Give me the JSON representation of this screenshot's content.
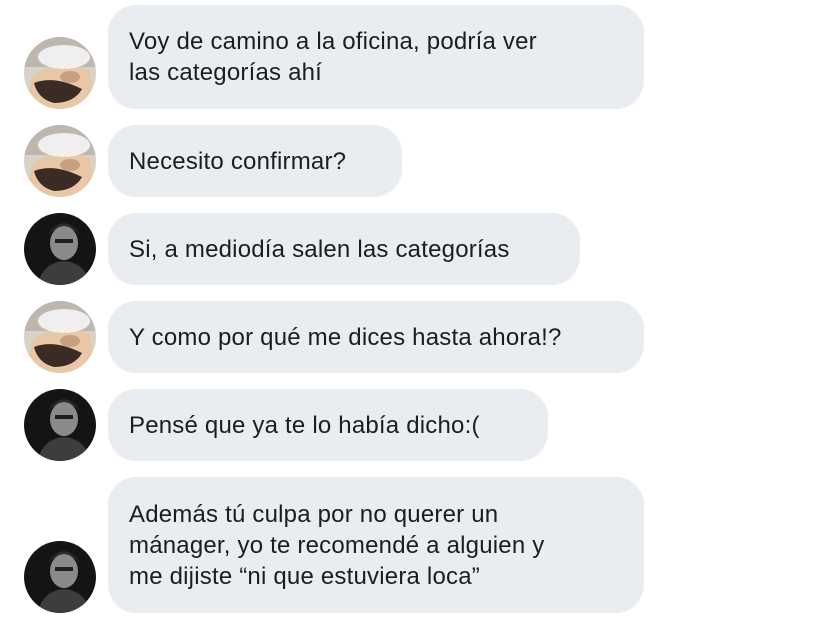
{
  "messages": [
    {
      "sender": "contact",
      "text": "Voy de camino a la oficina, podría ver\nlas categorías ahí"
    },
    {
      "sender": "contact",
      "text": "Necesito confirmar?"
    },
    {
      "sender": "user",
      "text": "Si, a mediodía salen las categorías"
    },
    {
      "sender": "contact",
      "text": "Y como por qué me dices hasta ahora!?"
    },
    {
      "sender": "user",
      "text": "Pensé que ya te lo había dicho:("
    },
    {
      "sender": "user",
      "text": "Además tú culpa por no querer un\nmánager, yo te recomendé a alguien y\nme dijiste “ni que estuviera loca”"
    }
  ],
  "avatars": {
    "contact": "light-portrait-avatar",
    "user": "dark-portrait-avatar"
  },
  "colors": {
    "bubble": "#e9edf2",
    "text": "#1b1d20"
  }
}
